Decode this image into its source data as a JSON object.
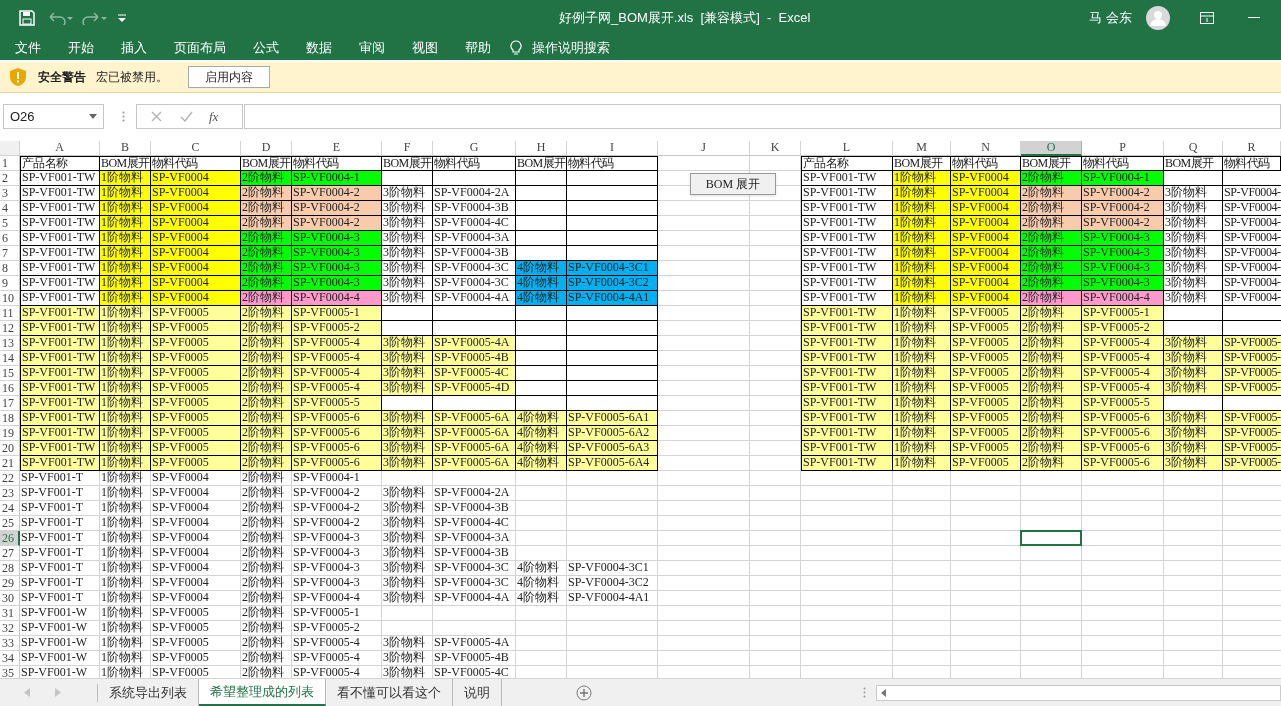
{
  "window": {
    "title": "好例子网_BOM展开.xls  [兼容模式]  -  Excel",
    "user": "马 会东"
  },
  "ribbon_tabs": [
    "文件",
    "开始",
    "插入",
    "页面布局",
    "公式",
    "数据",
    "审阅",
    "视图",
    "帮助"
  ],
  "tell_me": "操作说明搜索",
  "security_bar": {
    "title": "安全警告",
    "message": "宏已被禁用。",
    "button": "启用内容"
  },
  "formula_bar": {
    "name_box": "O26",
    "function_label": "fx"
  },
  "sheet": {
    "button": "BOM 展开",
    "columns": [
      {
        "label": "A",
        "selected": false
      },
      {
        "label": "B",
        "selected": false
      },
      {
        "label": "C",
        "selected": false
      },
      {
        "label": "D",
        "selected": false
      },
      {
        "label": "E",
        "selected": false
      },
      {
        "label": "F",
        "selected": false
      },
      {
        "label": "G",
        "selected": false
      },
      {
        "label": "H",
        "selected": false
      },
      {
        "label": "I",
        "selected": false
      },
      {
        "label": "J",
        "selected": false
      },
      {
        "label": "K",
        "selected": false
      },
      {
        "label": "L",
        "selected": false
      },
      {
        "label": "M",
        "selected": false
      },
      {
        "label": "N",
        "selected": false
      },
      {
        "label": "O",
        "selected": true
      },
      {
        "label": "P",
        "selected": false
      },
      {
        "label": "Q",
        "selected": false
      },
      {
        "label": "R",
        "selected": false
      }
    ],
    "rows": [
      {
        "number": "1",
        "selected": false,
        "bordered": true,
        "left": [
          {
            "text": "产品名称"
          },
          {
            "text": "BOM展开"
          },
          {
            "text": "物料代码"
          },
          {
            "text": "BOM展开"
          },
          {
            "text": "物料代码"
          },
          {
            "text": "BOM展开"
          },
          {
            "text": "物料代码"
          },
          {
            "text": "BOM展开"
          },
          {
            "text": "物料代码"
          }
        ],
        "right": [
          {
            "text": "产品名称"
          },
          {
            "text": "BOM展开"
          },
          {
            "text": "物料代码"
          },
          {
            "text": "BOM展开"
          },
          {
            "text": "物料代码"
          },
          {
            "text": "BOM展开"
          },
          {
            "text": "物料代码"
          }
        ]
      },
      {
        "number": "2",
        "selected": false,
        "bordered": true,
        "left": [
          {
            "text": "SP-VF001-TW"
          },
          {
            "text": "1阶物料",
            "color": "#ffff00"
          },
          {
            "text": "SP-VF0004",
            "color": "#ffff00"
          },
          {
            "text": "2阶物料",
            "color": "#00ff00"
          },
          {
            "text": "SP-VF0004-1",
            "color": "#00ff00"
          }
        ],
        "right": [
          {
            "text": "SP-VF001-TW"
          },
          {
            "text": "1阶物料",
            "color": "#ffff00"
          },
          {
            "text": "SP-VF0004",
            "color": "#ffff00"
          },
          {
            "text": "2阶物料",
            "color": "#00ff00"
          },
          {
            "text": "SP-VF0004-1",
            "color": "#00ff00"
          }
        ]
      },
      {
        "number": "3",
        "selected": false,
        "bordered": true,
        "left": [
          {
            "text": "SP-VF001-TW"
          },
          {
            "text": "1阶物料",
            "color": "#ffff00"
          },
          {
            "text": "SP-VF0004",
            "color": "#ffff00"
          },
          {
            "text": "2阶物料",
            "color": "#f8cbad"
          },
          {
            "text": "SP-VF0004-2",
            "color": "#f8cbad"
          },
          {
            "text": "3阶物料"
          },
          {
            "text": "SP-VF0004-2A"
          }
        ],
        "right": [
          {
            "text": "SP-VF001-TW"
          },
          {
            "text": "1阶物料",
            "color": "#ffff00"
          },
          {
            "text": "SP-VF0004",
            "color": "#ffff00"
          },
          {
            "text": "2阶物料",
            "color": "#f8cbad"
          },
          {
            "text": "SP-VF0004-2",
            "color": "#f8cbad"
          },
          {
            "text": "3阶物料"
          },
          {
            "text": "SP-VF0004-"
          }
        ]
      },
      {
        "number": "4",
        "selected": false,
        "bordered": true,
        "left": [
          {
            "text": "SP-VF001-TW"
          },
          {
            "text": "1阶物料",
            "color": "#ffff00"
          },
          {
            "text": "SP-VF0004",
            "color": "#ffff00"
          },
          {
            "text": "2阶物料",
            "color": "#f8cbad"
          },
          {
            "text": "SP-VF0004-2",
            "color": "#f8cbad"
          },
          {
            "text": "3阶物料"
          },
          {
            "text": "SP-VF0004-3B"
          }
        ],
        "right": [
          {
            "text": "SP-VF001-TW"
          },
          {
            "text": "1阶物料",
            "color": "#ffff00"
          },
          {
            "text": "SP-VF0004",
            "color": "#ffff00"
          },
          {
            "text": "2阶物料",
            "color": "#f8cbad"
          },
          {
            "text": "SP-VF0004-2",
            "color": "#f8cbad"
          },
          {
            "text": "3阶物料"
          },
          {
            "text": "SP-VF0004-"
          }
        ]
      },
      {
        "number": "5",
        "selected": false,
        "bordered": true,
        "left": [
          {
            "text": "SP-VF001-TW"
          },
          {
            "text": "1阶物料",
            "color": "#ffff00"
          },
          {
            "text": "SP-VF0004",
            "color": "#ffff00"
          },
          {
            "text": "2阶物料",
            "color": "#f8cbad"
          },
          {
            "text": "SP-VF0004-2",
            "color": "#f8cbad"
          },
          {
            "text": "3阶物料"
          },
          {
            "text": "SP-VF0004-4C"
          }
        ],
        "right": [
          {
            "text": "SP-VF001-TW"
          },
          {
            "text": "1阶物料",
            "color": "#ffff00"
          },
          {
            "text": "SP-VF0004",
            "color": "#ffff00"
          },
          {
            "text": "2阶物料",
            "color": "#f8cbad"
          },
          {
            "text": "SP-VF0004-2",
            "color": "#f8cbad"
          },
          {
            "text": "3阶物料"
          },
          {
            "text": "SP-VF0004-"
          }
        ]
      },
      {
        "number": "6",
        "selected": false,
        "bordered": true,
        "left": [
          {
            "text": "SP-VF001-TW"
          },
          {
            "text": "1阶物料",
            "color": "#ffff00"
          },
          {
            "text": "SP-VF0004",
            "color": "#ffff00"
          },
          {
            "text": "2阶物料",
            "color": "#00ff00"
          },
          {
            "text": "SP-VF0004-3",
            "color": "#00ff00"
          },
          {
            "text": "3阶物料"
          },
          {
            "text": "SP-VF0004-3A"
          }
        ],
        "right": [
          {
            "text": "SP-VF001-TW"
          },
          {
            "text": "1阶物料",
            "color": "#ffff00"
          },
          {
            "text": "SP-VF0004",
            "color": "#ffff00"
          },
          {
            "text": "2阶物料",
            "color": "#00ff00"
          },
          {
            "text": "SP-VF0004-3",
            "color": "#00ff00"
          },
          {
            "text": "3阶物料"
          },
          {
            "text": "SP-VF0004-"
          }
        ]
      },
      {
        "number": "7",
        "selected": false,
        "bordered": true,
        "left": [
          {
            "text": "SP-VF001-TW"
          },
          {
            "text": "1阶物料",
            "color": "#ffff00"
          },
          {
            "text": "SP-VF0004",
            "color": "#ffff00"
          },
          {
            "text": "2阶物料",
            "color": "#00ff00"
          },
          {
            "text": "SP-VF0004-3",
            "color": "#00ff00"
          },
          {
            "text": "3阶物料"
          },
          {
            "text": "SP-VF0004-3B"
          }
        ],
        "right": [
          {
            "text": "SP-VF001-TW"
          },
          {
            "text": "1阶物料",
            "color": "#ffff00"
          },
          {
            "text": "SP-VF0004",
            "color": "#ffff00"
          },
          {
            "text": "2阶物料",
            "color": "#00ff00"
          },
          {
            "text": "SP-VF0004-3",
            "color": "#00ff00"
          },
          {
            "text": "3阶物料"
          },
          {
            "text": "SP-VF0004-"
          }
        ]
      },
      {
        "number": "8",
        "selected": false,
        "bordered": true,
        "left": [
          {
            "text": "SP-VF001-TW"
          },
          {
            "text": "1阶物料",
            "color": "#ffff00"
          },
          {
            "text": "SP-VF0004",
            "color": "#ffff00"
          },
          {
            "text": "2阶物料",
            "color": "#00ff00"
          },
          {
            "text": "SP-VF0004-3",
            "color": "#00ff00"
          },
          {
            "text": "3阶物料"
          },
          {
            "text": "SP-VF0004-3C"
          },
          {
            "text": "4阶物料",
            "color": "#00b0f0"
          },
          {
            "text": "SP-VF0004-3C1",
            "color": "#00b0f0"
          }
        ],
        "right": [
          {
            "text": "SP-VF001-TW"
          },
          {
            "text": "1阶物料",
            "color": "#ffff00"
          },
          {
            "text": "SP-VF0004",
            "color": "#ffff00"
          },
          {
            "text": "2阶物料",
            "color": "#00ff00"
          },
          {
            "text": "SP-VF0004-3",
            "color": "#00ff00"
          },
          {
            "text": "3阶物料"
          },
          {
            "text": "SP-VF0004-"
          }
        ]
      },
      {
        "number": "9",
        "selected": false,
        "bordered": true,
        "left": [
          {
            "text": "SP-VF001-TW"
          },
          {
            "text": "1阶物料",
            "color": "#ffff00"
          },
          {
            "text": "SP-VF0004",
            "color": "#ffff00"
          },
          {
            "text": "2阶物料",
            "color": "#00ff00"
          },
          {
            "text": "SP-VF0004-3",
            "color": "#00ff00"
          },
          {
            "text": "3阶物料"
          },
          {
            "text": "SP-VF0004-3C"
          },
          {
            "text": "4阶物料",
            "color": "#00b0f0"
          },
          {
            "text": "SP-VF0004-3C2",
            "color": "#00b0f0"
          }
        ],
        "right": [
          {
            "text": "SP-VF001-TW"
          },
          {
            "text": "1阶物料",
            "color": "#ffff00"
          },
          {
            "text": "SP-VF0004",
            "color": "#ffff00"
          },
          {
            "text": "2阶物料",
            "color": "#00ff00"
          },
          {
            "text": "SP-VF0004-3",
            "color": "#00ff00"
          },
          {
            "text": "3阶物料"
          },
          {
            "text": "SP-VF0004-"
          }
        ]
      },
      {
        "number": "10",
        "selected": false,
        "bordered": true,
        "left": [
          {
            "text": "SP-VF001-TW"
          },
          {
            "text": "1阶物料",
            "color": "#ffff00"
          },
          {
            "text": "SP-VF0004",
            "color": "#ffff00"
          },
          {
            "text": "2阶物料",
            "color": "#ff99cc"
          },
          {
            "text": "SP-VF0004-4",
            "color": "#ff99cc"
          },
          {
            "text": "3阶物料"
          },
          {
            "text": "SP-VF0004-4A"
          },
          {
            "text": "4阶物料",
            "color": "#00b0f0"
          },
          {
            "text": "SP-VF0004-4A1",
            "color": "#00b0f0"
          }
        ],
        "right": [
          {
            "text": "SP-VF001-TW"
          },
          {
            "text": "1阶物料",
            "color": "#ffff00"
          },
          {
            "text": "SP-VF0004",
            "color": "#ffff00"
          },
          {
            "text": "2阶物料",
            "color": "#ff99cc"
          },
          {
            "text": "SP-VF0004-4",
            "color": "#ff99cc"
          },
          {
            "text": "3阶物料"
          },
          {
            "text": "SP-VF0004-"
          }
        ]
      },
      {
        "number": "11",
        "selected": false,
        "bordered": true,
        "left": [
          {
            "text": "SP-VF001-TW",
            "color": "#ffff99"
          },
          {
            "text": "1阶物料",
            "color": "#ffff99"
          },
          {
            "text": "SP-VF0005",
            "color": "#ffff99"
          },
          {
            "text": "2阶物料",
            "color": "#ffff99"
          },
          {
            "text": "SP-VF0005-1",
            "color": "#ffff99"
          }
        ],
        "right": [
          {
            "text": "SP-VF001-TW",
            "color": "#ffff99"
          },
          {
            "text": "1阶物料",
            "color": "#ffff99"
          },
          {
            "text": "SP-VF0005",
            "color": "#ffff99"
          },
          {
            "text": "2阶物料",
            "color": "#ffff99"
          },
          {
            "text": "SP-VF0005-1",
            "color": "#ffff99"
          }
        ]
      },
      {
        "number": "12",
        "selected": false,
        "bordered": true,
        "left": [
          {
            "text": "SP-VF001-TW",
            "color": "#ffff99"
          },
          {
            "text": "1阶物料",
            "color": "#ffff99"
          },
          {
            "text": "SP-VF0005",
            "color": "#ffff99"
          },
          {
            "text": "2阶物料",
            "color": "#ffff99"
          },
          {
            "text": "SP-VF0005-2",
            "color": "#ffff99"
          }
        ],
        "right": [
          {
            "text": "SP-VF001-TW",
            "color": "#ffff99"
          },
          {
            "text": "1阶物料",
            "color": "#ffff99"
          },
          {
            "text": "SP-VF0005",
            "color": "#ffff99"
          },
          {
            "text": "2阶物料",
            "color": "#ffff99"
          },
          {
            "text": "SP-VF0005-2",
            "color": "#ffff99"
          }
        ]
      },
      {
        "number": "13",
        "selected": false,
        "bordered": true,
        "left": [
          {
            "text": "SP-VF001-TW",
            "color": "#ffff99"
          },
          {
            "text": "1阶物料",
            "color": "#ffff99"
          },
          {
            "text": "SP-VF0005",
            "color": "#ffff99"
          },
          {
            "text": "2阶物料",
            "color": "#ffff99"
          },
          {
            "text": "SP-VF0005-4",
            "color": "#ffff99"
          },
          {
            "text": "3阶物料",
            "color": "#ffff99"
          },
          {
            "text": "SP-VF0005-4A",
            "color": "#ffff99"
          }
        ],
        "right": [
          {
            "text": "SP-VF001-TW",
            "color": "#ffff99"
          },
          {
            "text": "1阶物料",
            "color": "#ffff99"
          },
          {
            "text": "SP-VF0005",
            "color": "#ffff99"
          },
          {
            "text": "2阶物料",
            "color": "#ffff99"
          },
          {
            "text": "SP-VF0005-4",
            "color": "#ffff99"
          },
          {
            "text": "3阶物料",
            "color": "#ffff99"
          },
          {
            "text": "SP-VF0005-",
            "color": "#ffff99"
          }
        ]
      },
      {
        "number": "14",
        "selected": false,
        "bordered": true,
        "left": [
          {
            "text": "SP-VF001-TW",
            "color": "#ffff99"
          },
          {
            "text": "1阶物料",
            "color": "#ffff99"
          },
          {
            "text": "SP-VF0005",
            "color": "#ffff99"
          },
          {
            "text": "2阶物料",
            "color": "#ffff99"
          },
          {
            "text": "SP-VF0005-4",
            "color": "#ffff99"
          },
          {
            "text": "3阶物料",
            "color": "#ffff99"
          },
          {
            "text": "SP-VF0005-4B",
            "color": "#ffff99"
          }
        ],
        "right": [
          {
            "text": "SP-VF001-TW",
            "color": "#ffff99"
          },
          {
            "text": "1阶物料",
            "color": "#ffff99"
          },
          {
            "text": "SP-VF0005",
            "color": "#ffff99"
          },
          {
            "text": "2阶物料",
            "color": "#ffff99"
          },
          {
            "text": "SP-VF0005-4",
            "color": "#ffff99"
          },
          {
            "text": "3阶物料",
            "color": "#ffff99"
          },
          {
            "text": "SP-VF0005-",
            "color": "#ffff99"
          }
        ]
      },
      {
        "number": "15",
        "selected": false,
        "bordered": true,
        "left": [
          {
            "text": "SP-VF001-TW",
            "color": "#ffff99"
          },
          {
            "text": "1阶物料",
            "color": "#ffff99"
          },
          {
            "text": "SP-VF0005",
            "color": "#ffff99"
          },
          {
            "text": "2阶物料",
            "color": "#ffff99"
          },
          {
            "text": "SP-VF0005-4",
            "color": "#ffff99"
          },
          {
            "text": "3阶物料",
            "color": "#ffff99"
          },
          {
            "text": "SP-VF0005-4C",
            "color": "#ffff99"
          }
        ],
        "right": [
          {
            "text": "SP-VF001-TW",
            "color": "#ffff99"
          },
          {
            "text": "1阶物料",
            "color": "#ffff99"
          },
          {
            "text": "SP-VF0005",
            "color": "#ffff99"
          },
          {
            "text": "2阶物料",
            "color": "#ffff99"
          },
          {
            "text": "SP-VF0005-4",
            "color": "#ffff99"
          },
          {
            "text": "3阶物料",
            "color": "#ffff99"
          },
          {
            "text": "SP-VF0005-",
            "color": "#ffff99"
          }
        ]
      },
      {
        "number": "16",
        "selected": false,
        "bordered": true,
        "left": [
          {
            "text": "SP-VF001-TW",
            "color": "#ffff99"
          },
          {
            "text": "1阶物料",
            "color": "#ffff99"
          },
          {
            "text": "SP-VF0005",
            "color": "#ffff99"
          },
          {
            "text": "2阶物料",
            "color": "#ffff99"
          },
          {
            "text": "SP-VF0005-4",
            "color": "#ffff99"
          },
          {
            "text": "3阶物料",
            "color": "#ffff99"
          },
          {
            "text": "SP-VF0005-4D",
            "color": "#ffff99"
          }
        ],
        "right": [
          {
            "text": "SP-VF001-TW",
            "color": "#ffff99"
          },
          {
            "text": "1阶物料",
            "color": "#ffff99"
          },
          {
            "text": "SP-VF0005",
            "color": "#ffff99"
          },
          {
            "text": "2阶物料",
            "color": "#ffff99"
          },
          {
            "text": "SP-VF0005-4",
            "color": "#ffff99"
          },
          {
            "text": "3阶物料",
            "color": "#ffff99"
          },
          {
            "text": "SP-VF0005-",
            "color": "#ffff99"
          }
        ]
      },
      {
        "number": "17",
        "selected": false,
        "bordered": true,
        "left": [
          {
            "text": "SP-VF001-TW",
            "color": "#ffff99"
          },
          {
            "text": "1阶物料",
            "color": "#ffff99"
          },
          {
            "text": "SP-VF0005",
            "color": "#ffff99"
          },
          {
            "text": "2阶物料",
            "color": "#ffff99"
          },
          {
            "text": "SP-VF0005-5",
            "color": "#ffff99"
          }
        ],
        "right": [
          {
            "text": "SP-VF001-TW",
            "color": "#ffff99"
          },
          {
            "text": "1阶物料",
            "color": "#ffff99"
          },
          {
            "text": "SP-VF0005",
            "color": "#ffff99"
          },
          {
            "text": "2阶物料",
            "color": "#ffff99"
          },
          {
            "text": "SP-VF0005-5",
            "color": "#ffff99"
          }
        ]
      },
      {
        "number": "18",
        "selected": false,
        "bordered": true,
        "left": [
          {
            "text": "SP-VF001-TW",
            "color": "#ffff99"
          },
          {
            "text": "1阶物料",
            "color": "#ffff99"
          },
          {
            "text": "SP-VF0005",
            "color": "#ffff99"
          },
          {
            "text": "2阶物料",
            "color": "#ffff99"
          },
          {
            "text": "SP-VF0005-6",
            "color": "#ffff99"
          },
          {
            "text": "3阶物料",
            "color": "#ffff99"
          },
          {
            "text": "SP-VF0005-6A",
            "color": "#ffff99"
          },
          {
            "text": "4阶物料",
            "color": "#ffff99"
          },
          {
            "text": "SP-VF0005-6A1",
            "color": "#ffff99"
          }
        ],
        "right": [
          {
            "text": "SP-VF001-TW",
            "color": "#ffff99"
          },
          {
            "text": "1阶物料",
            "color": "#ffff99"
          },
          {
            "text": "SP-VF0005",
            "color": "#ffff99"
          },
          {
            "text": "2阶物料",
            "color": "#ffff99"
          },
          {
            "text": "SP-VF0005-6",
            "color": "#ffff99"
          },
          {
            "text": "3阶物料",
            "color": "#ffff99"
          },
          {
            "text": "SP-VF0005-",
            "color": "#ffff99"
          }
        ]
      },
      {
        "number": "19",
        "selected": false,
        "bordered": true,
        "left": [
          {
            "text": "SP-VF001-TW",
            "color": "#ffff99"
          },
          {
            "text": "1阶物料",
            "color": "#ffff99"
          },
          {
            "text": "SP-VF0005",
            "color": "#ffff99"
          },
          {
            "text": "2阶物料",
            "color": "#ffff99"
          },
          {
            "text": "SP-VF0005-6",
            "color": "#ffff99"
          },
          {
            "text": "3阶物料",
            "color": "#ffff99"
          },
          {
            "text": "SP-VF0005-6A",
            "color": "#ffff99"
          },
          {
            "text": "4阶物料",
            "color": "#ffff99"
          },
          {
            "text": "SP-VF0005-6A2",
            "color": "#ffff99"
          }
        ],
        "right": [
          {
            "text": "SP-VF001-TW",
            "color": "#ffff99"
          },
          {
            "text": "1阶物料",
            "color": "#ffff99"
          },
          {
            "text": "SP-VF0005",
            "color": "#ffff99"
          },
          {
            "text": "2阶物料",
            "color": "#ffff99"
          },
          {
            "text": "SP-VF0005-6",
            "color": "#ffff99"
          },
          {
            "text": "3阶物料",
            "color": "#ffff99"
          },
          {
            "text": "SP-VF0005-",
            "color": "#ffff99"
          }
        ]
      },
      {
        "number": "20",
        "selected": false,
        "bordered": true,
        "left": [
          {
            "text": "SP-VF001-TW",
            "color": "#ffff99"
          },
          {
            "text": "1阶物料",
            "color": "#ffff99"
          },
          {
            "text": "SP-VF0005",
            "color": "#ffff99"
          },
          {
            "text": "2阶物料",
            "color": "#ffff99"
          },
          {
            "text": "SP-VF0005-6",
            "color": "#ffff99"
          },
          {
            "text": "3阶物料",
            "color": "#ffff99"
          },
          {
            "text": "SP-VF0005-6A",
            "color": "#ffff99"
          },
          {
            "text": "4阶物料",
            "color": "#ffff99"
          },
          {
            "text": "SP-VF0005-6A3",
            "color": "#ffff99"
          }
        ],
        "right": [
          {
            "text": "SP-VF001-TW",
            "color": "#ffff99"
          },
          {
            "text": "1阶物料",
            "color": "#ffff99"
          },
          {
            "text": "SP-VF0005",
            "color": "#ffff99"
          },
          {
            "text": "2阶物料",
            "color": "#ffff99"
          },
          {
            "text": "SP-VF0005-6",
            "color": "#ffff99"
          },
          {
            "text": "3阶物料",
            "color": "#ffff99"
          },
          {
            "text": "SP-VF0005-",
            "color": "#ffff99"
          }
        ]
      },
      {
        "number": "21",
        "selected": false,
        "bordered": true,
        "left": [
          {
            "text": "SP-VF001-TW",
            "color": "#ffff99"
          },
          {
            "text": "1阶物料",
            "color": "#ffff99"
          },
          {
            "text": "SP-VF0005",
            "color": "#ffff99"
          },
          {
            "text": "2阶物料",
            "color": "#ffff99"
          },
          {
            "text": "SP-VF0005-6",
            "color": "#ffff99"
          },
          {
            "text": "3阶物料",
            "color": "#ffff99"
          },
          {
            "text": "SP-VF0005-6A",
            "color": "#ffff99"
          },
          {
            "text": "4阶物料",
            "color": "#ffff99"
          },
          {
            "text": "SP-VF0005-6A4",
            "color": "#ffff99"
          }
        ],
        "right": [
          {
            "text": "SP-VF001-TW",
            "color": "#ffff99"
          },
          {
            "text": "1阶物料",
            "color": "#ffff99"
          },
          {
            "text": "SP-VF0005",
            "color": "#ffff99"
          },
          {
            "text": "2阶物料",
            "color": "#ffff99"
          },
          {
            "text": "SP-VF0005-6",
            "color": "#ffff99"
          },
          {
            "text": "3阶物料",
            "color": "#ffff99"
          },
          {
            "text": "SP-VF0005-",
            "color": "#ffff99"
          }
        ]
      },
      {
        "number": "22",
        "selected": false,
        "bordered": false,
        "left": [
          {
            "text": "SP-VF001-T"
          },
          {
            "text": "1阶物料"
          },
          {
            "text": "SP-VF0004"
          },
          {
            "text": "2阶物料"
          },
          {
            "text": "SP-VF0004-1"
          }
        ]
      },
      {
        "number": "23",
        "selected": false,
        "bordered": false,
        "left": [
          {
            "text": "SP-VF001-T"
          },
          {
            "text": "1阶物料"
          },
          {
            "text": "SP-VF0004"
          },
          {
            "text": "2阶物料"
          },
          {
            "text": "SP-VF0004-2"
          },
          {
            "text": "3阶物料"
          },
          {
            "text": "SP-VF0004-2A"
          }
        ]
      },
      {
        "number": "24",
        "selected": false,
        "bordered": false,
        "left": [
          {
            "text": "SP-VF001-T"
          },
          {
            "text": "1阶物料"
          },
          {
            "text": "SP-VF0004"
          },
          {
            "text": "2阶物料"
          },
          {
            "text": "SP-VF0004-2"
          },
          {
            "text": "3阶物料"
          },
          {
            "text": "SP-VF0004-3B"
          }
        ]
      },
      {
        "number": "25",
        "selected": false,
        "bordered": false,
        "left": [
          {
            "text": "SP-VF001-T"
          },
          {
            "text": "1阶物料"
          },
          {
            "text": "SP-VF0004"
          },
          {
            "text": "2阶物料"
          },
          {
            "text": "SP-VF0004-2"
          },
          {
            "text": "3阶物料"
          },
          {
            "text": "SP-VF0004-4C"
          }
        ]
      },
      {
        "number": "26",
        "selected": true,
        "bordered": false,
        "left": [
          {
            "text": "SP-VF001-T"
          },
          {
            "text": "1阶物料"
          },
          {
            "text": "SP-VF0004"
          },
          {
            "text": "2阶物料"
          },
          {
            "text": "SP-VF0004-3"
          },
          {
            "text": "3阶物料"
          },
          {
            "text": "SP-VF0004-3A"
          }
        ]
      },
      {
        "number": "27",
        "selected": false,
        "bordered": false,
        "left": [
          {
            "text": "SP-VF001-T"
          },
          {
            "text": "1阶物料"
          },
          {
            "text": "SP-VF0004"
          },
          {
            "text": "2阶物料"
          },
          {
            "text": "SP-VF0004-3"
          },
          {
            "text": "3阶物料"
          },
          {
            "text": "SP-VF0004-3B"
          }
        ]
      },
      {
        "number": "28",
        "selected": false,
        "bordered": false,
        "left": [
          {
            "text": "SP-VF001-T"
          },
          {
            "text": "1阶物料"
          },
          {
            "text": "SP-VF0004"
          },
          {
            "text": "2阶物料"
          },
          {
            "text": "SP-VF0004-3"
          },
          {
            "text": "3阶物料"
          },
          {
            "text": "SP-VF0004-3C"
          },
          {
            "text": "4阶物料"
          },
          {
            "text": "SP-VF0004-3C1"
          }
        ]
      },
      {
        "number": "29",
        "selected": false,
        "bordered": false,
        "left": [
          {
            "text": "SP-VF001-T"
          },
          {
            "text": "1阶物料"
          },
          {
            "text": "SP-VF0004"
          },
          {
            "text": "2阶物料"
          },
          {
            "text": "SP-VF0004-3"
          },
          {
            "text": "3阶物料"
          },
          {
            "text": "SP-VF0004-3C"
          },
          {
            "text": "4阶物料"
          },
          {
            "text": "SP-VF0004-3C2"
          }
        ]
      },
      {
        "number": "30",
        "selected": false,
        "bordered": false,
        "left": [
          {
            "text": "SP-VF001-T"
          },
          {
            "text": "1阶物料"
          },
          {
            "text": "SP-VF0004"
          },
          {
            "text": "2阶物料"
          },
          {
            "text": "SP-VF0004-4"
          },
          {
            "text": "3阶物料"
          },
          {
            "text": "SP-VF0004-4A"
          },
          {
            "text": "4阶物料"
          },
          {
            "text": "SP-VF0004-4A1"
          }
        ]
      },
      {
        "number": "31",
        "selected": false,
        "bordered": false,
        "left": [
          {
            "text": "SP-VF001-W"
          },
          {
            "text": "1阶物料"
          },
          {
            "text": "SP-VF0005"
          },
          {
            "text": "2阶物料"
          },
          {
            "text": "SP-VF0005-1"
          }
        ]
      },
      {
        "number": "32",
        "selected": false,
        "bordered": false,
        "left": [
          {
            "text": "SP-VF001-W"
          },
          {
            "text": "1阶物料"
          },
          {
            "text": "SP-VF0005"
          },
          {
            "text": "2阶物料"
          },
          {
            "text": "SP-VF0005-2"
          }
        ]
      },
      {
        "number": "33",
        "selected": false,
        "bordered": false,
        "left": [
          {
            "text": "SP-VF001-W"
          },
          {
            "text": "1阶物料"
          },
          {
            "text": "SP-VF0005"
          },
          {
            "text": "2阶物料"
          },
          {
            "text": "SP-VF0005-4"
          },
          {
            "text": "3阶物料"
          },
          {
            "text": "SP-VF0005-4A"
          }
        ]
      },
      {
        "number": "34",
        "selected": false,
        "bordered": false,
        "left": [
          {
            "text": "SP-VF001-W"
          },
          {
            "text": "1阶物料"
          },
          {
            "text": "SP-VF0005"
          },
          {
            "text": "2阶物料"
          },
          {
            "text": "SP-VF0005-4"
          },
          {
            "text": "3阶物料"
          },
          {
            "text": "SP-VF0005-4B"
          }
        ]
      },
      {
        "number": "35",
        "selected": false,
        "bordered": false,
        "left": [
          {
            "text": "SP-VF001-W"
          },
          {
            "text": "1阶物料"
          },
          {
            "text": "SP-VF0005"
          },
          {
            "text": "2阶物料"
          },
          {
            "text": "SP-VF0005-4"
          },
          {
            "text": "3阶物料"
          },
          {
            "text": "SP-VF0005-4C"
          }
        ]
      }
    ]
  },
  "sheet_tabs": [
    {
      "label": "系统导出列表",
      "selected": false
    },
    {
      "label": "希望整理成的列表",
      "selected": true
    },
    {
      "label": "看不懂可以看这个",
      "selected": false
    },
    {
      "label": "说明",
      "selected": false
    }
  ]
}
